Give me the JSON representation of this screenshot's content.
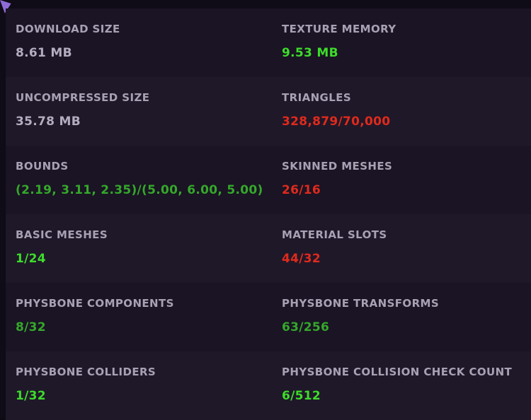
{
  "colors": {
    "neutral": "#b4adc0",
    "excellent": "#3ddc2a",
    "good": "#35a82a",
    "poor": "#e02a1c",
    "label": "#a8a1b4",
    "background": "#0f0b17"
  },
  "corner_icon": "corner-triangle-icon",
  "stats": [
    {
      "left": {
        "label": "DOWNLOAD SIZE",
        "value": "8.61 MB",
        "status": "neutral"
      },
      "right": {
        "label": "TEXTURE MEMORY",
        "value": "9.53 MB",
        "status": "excellent"
      }
    },
    {
      "left": {
        "label": "UNCOMPRESSED SIZE",
        "value": "35.78 MB",
        "status": "neutral"
      },
      "right": {
        "label": "TRIANGLES",
        "value": "328,879/70,000",
        "status": "poor"
      }
    },
    {
      "left": {
        "label": "BOUNDS",
        "value": "(2.19, 3.11, 2.35)/(5.00, 6.00, 5.00)",
        "status": "good"
      },
      "right": {
        "label": "SKINNED MESHES",
        "value": "26/16",
        "status": "poor"
      }
    },
    {
      "left": {
        "label": "BASIC MESHES",
        "value": "1/24",
        "status": "excellent"
      },
      "right": {
        "label": "MATERIAL SLOTS",
        "value": "44/32",
        "status": "poor"
      }
    },
    {
      "left": {
        "label": "PHYSBONE COMPONENTS",
        "value": "8/32",
        "status": "good"
      },
      "right": {
        "label": "PHYSBONE TRANSFORMS",
        "value": "63/256",
        "status": "good"
      }
    },
    {
      "left": {
        "label": "PHYSBONE COLLIDERS",
        "value": "1/32",
        "status": "excellent"
      },
      "right": {
        "label": "PHYSBONE COLLISION CHECK COUNT",
        "value": "6/512",
        "status": "excellent"
      }
    }
  ]
}
